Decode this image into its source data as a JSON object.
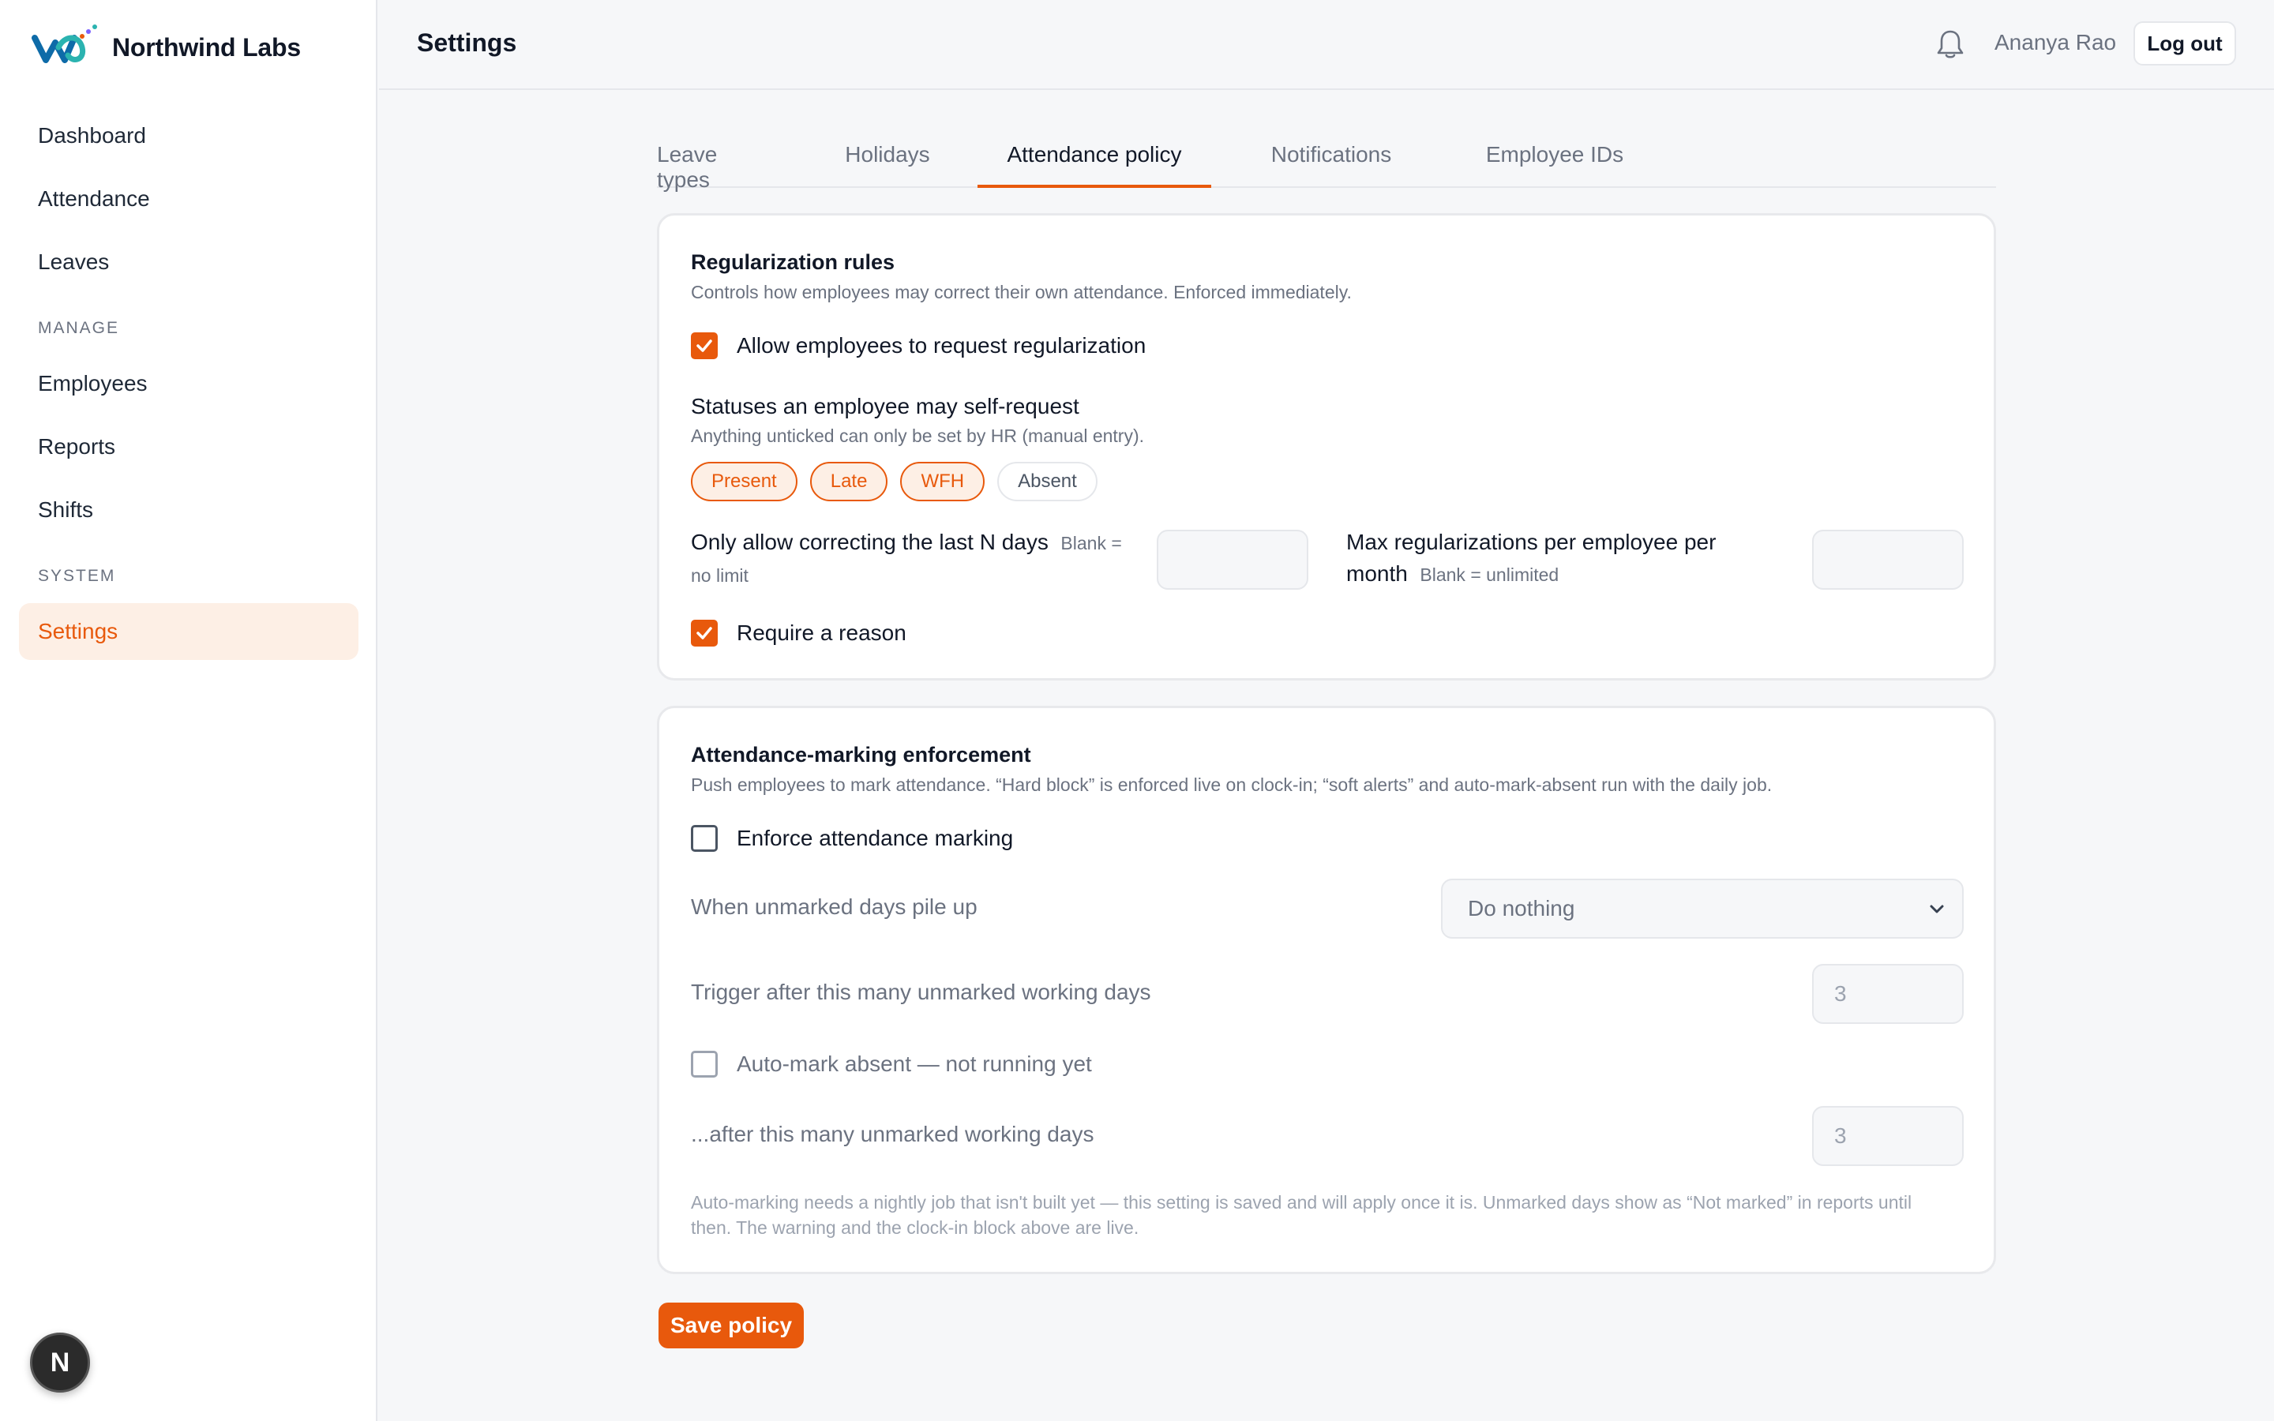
{
  "brand": {
    "name": "Northwind Labs"
  },
  "sidebar": {
    "items": [
      {
        "label": "Dashboard"
      },
      {
        "label": "Attendance"
      },
      {
        "label": "Leaves"
      }
    ],
    "manage_heading": "MANAGE",
    "manage_items": [
      {
        "label": "Employees"
      },
      {
        "label": "Reports"
      },
      {
        "label": "Shifts"
      }
    ],
    "system_heading": "SYSTEM",
    "system_items": [
      {
        "label": "Settings",
        "active": true
      }
    ],
    "fab_label": "N"
  },
  "header": {
    "title": "Settings",
    "user_name": "Ananya Rao",
    "logout_label": "Log out",
    "icons": [
      "bell-icon"
    ]
  },
  "tabs": [
    {
      "label": "Leave types"
    },
    {
      "label": "Holidays"
    },
    {
      "label": "Attendance policy",
      "active": true
    },
    {
      "label": "Notifications"
    },
    {
      "label": "Employee IDs"
    }
  ],
  "regularization": {
    "title": "Regularization rules",
    "subtitle": "Controls how employees may correct their own attendance. Enforced immediately.",
    "allow_label": "Allow employees to request regularization",
    "allow_checked": true,
    "statuses_title": "Statuses an employee may self-request",
    "statuses_subtitle": "Anything unticked can only be set by HR (manual entry).",
    "statuses": [
      {
        "label": "Present",
        "selected": true
      },
      {
        "label": "Late",
        "selected": true
      },
      {
        "label": "WFH",
        "selected": true
      },
      {
        "label": "Absent",
        "selected": false
      }
    ],
    "last_n_days_label": "Only allow correcting the last N days",
    "last_n_days_hint": "Blank = no limit",
    "last_n_days_value": "",
    "max_per_month_label": "Max regularizations per employee per month",
    "max_per_month_hint": "Blank = unlimited",
    "max_per_month_value": "",
    "require_reason_label": "Require a reason",
    "require_reason_checked": true
  },
  "enforcement": {
    "title": "Attendance-marking enforcement",
    "subtitle": "Push employees to mark attendance. “Hard block” is enforced live on clock-in; “soft alerts” and auto-mark-absent run with the daily job.",
    "enforce_label": "Enforce attendance marking",
    "enforce_checked": false,
    "pile_up_label": "When unmarked days pile up",
    "pile_up_value": "Do nothing",
    "trigger_label": "Trigger after this many unmarked working days",
    "trigger_value": "3",
    "auto_mark_label": "Auto-mark absent — not running yet",
    "auto_mark_checked": false,
    "after_label": "...after this many unmarked working days",
    "after_value": "3",
    "footnote": "Auto-marking needs a nightly job that isn't built yet — this setting is saved and will apply once it is. Unmarked days show as “Not marked” in reports until then. The warning and the clock-in block above are live."
  },
  "save_label": "Save policy",
  "colors": {
    "accent": "#e8590c",
    "accent_bg": "#fdefe5"
  }
}
